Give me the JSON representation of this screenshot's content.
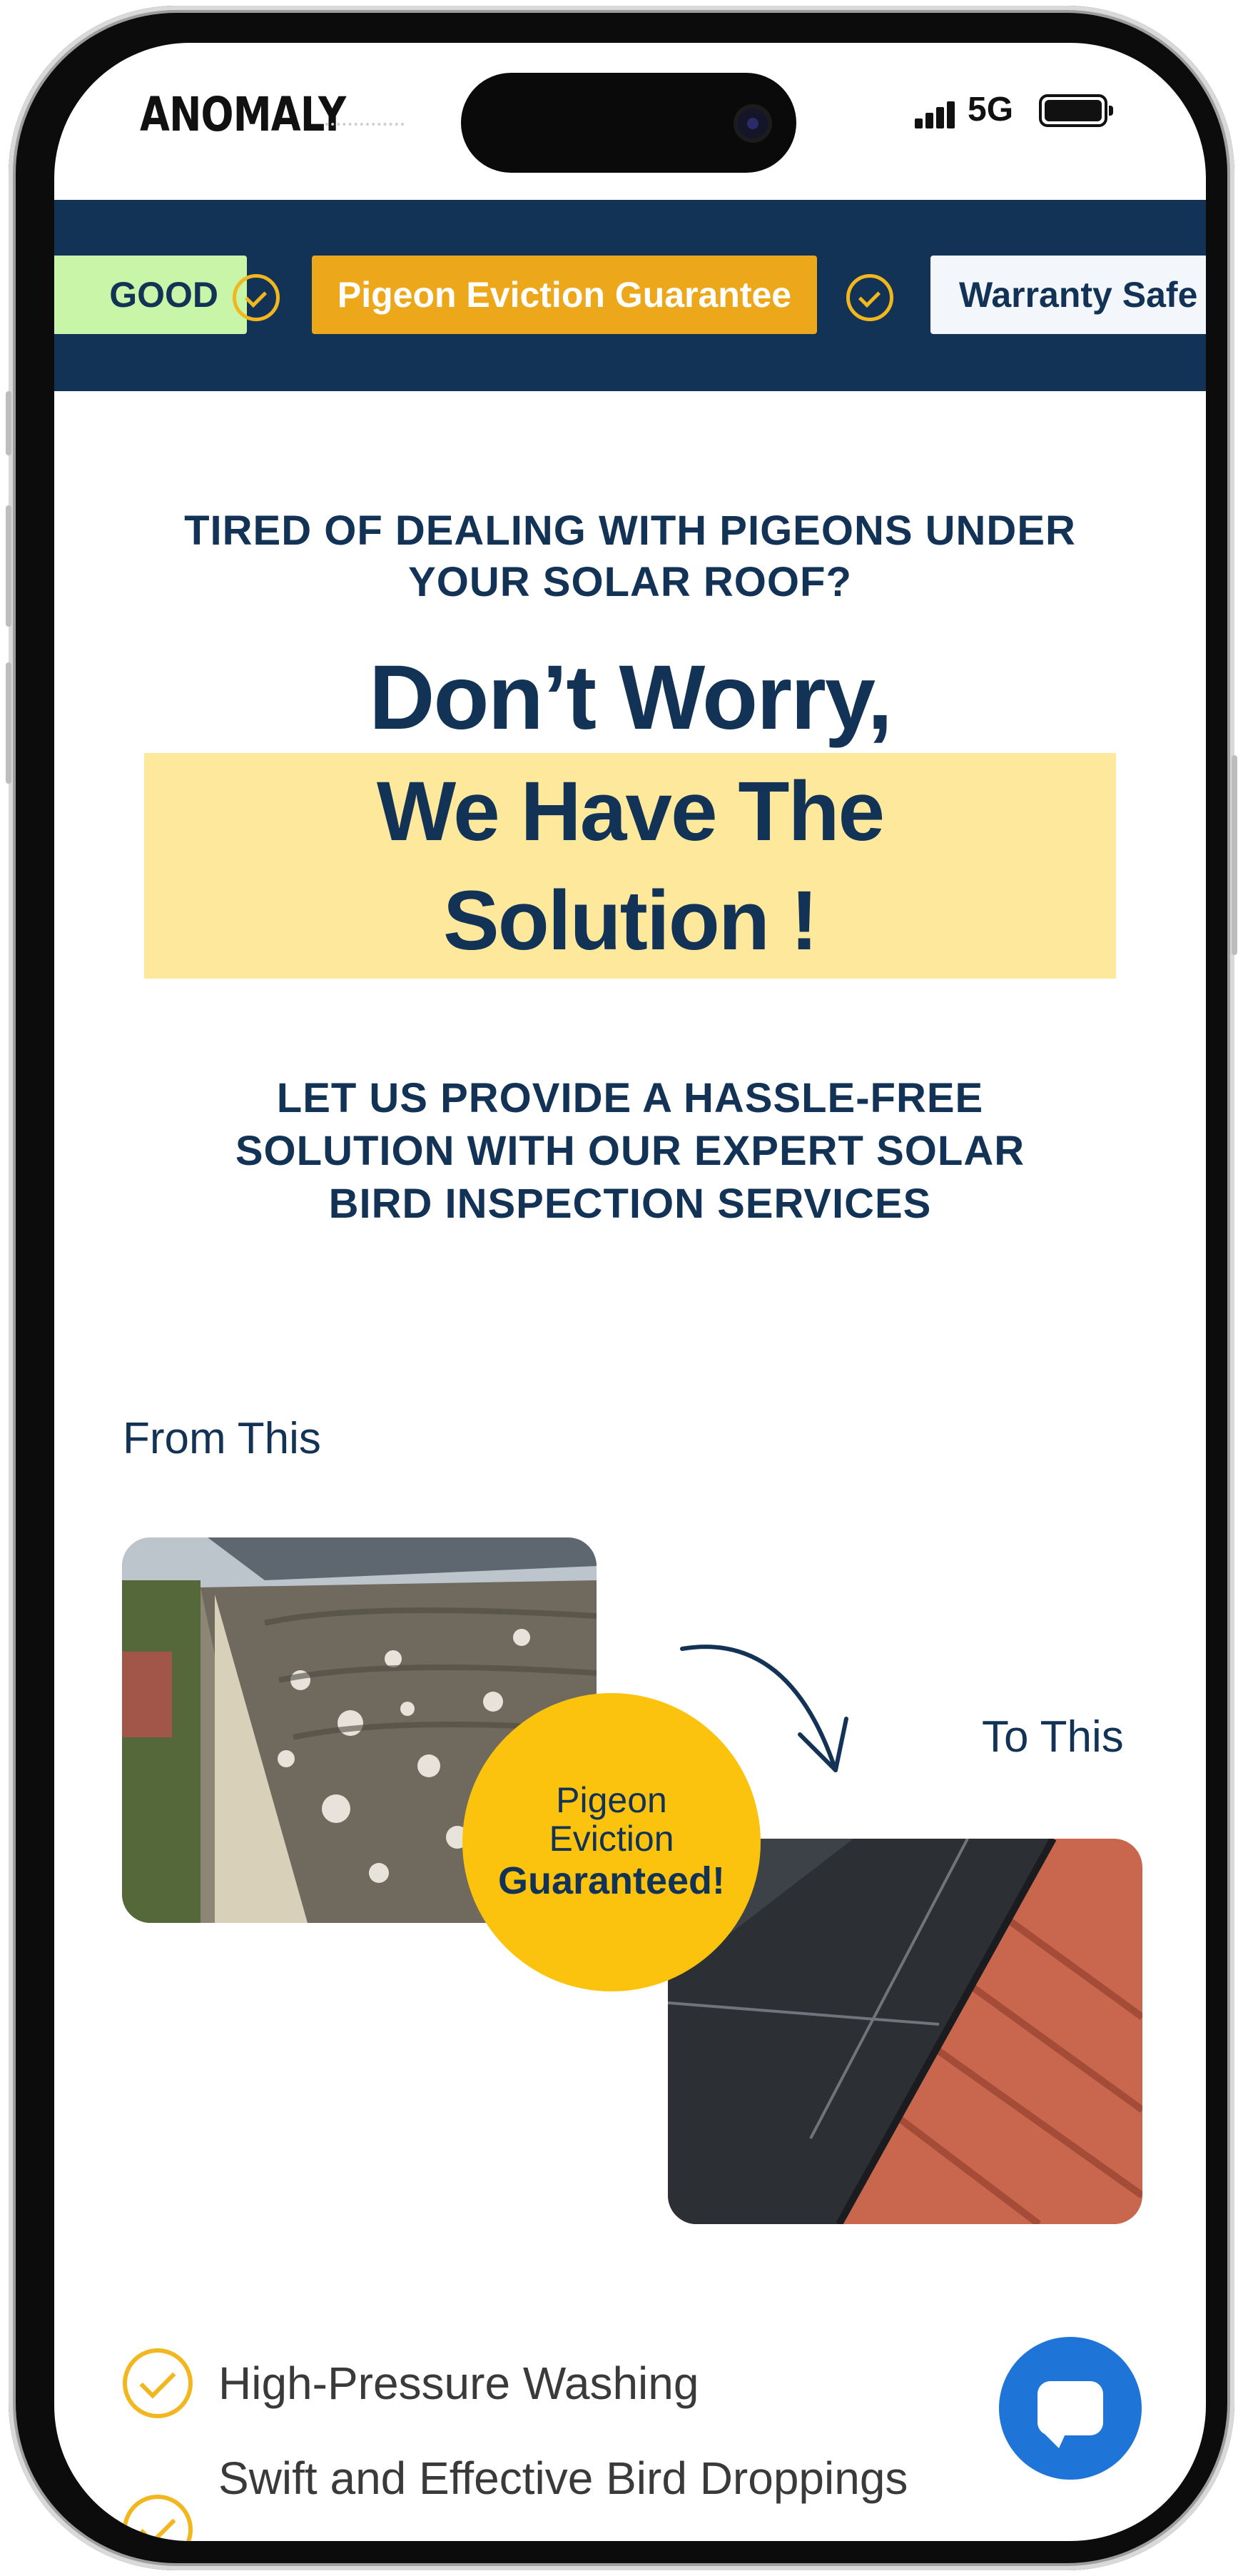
{
  "status_bar": {
    "brand": "ANOMALY",
    "network": "5G"
  },
  "ribbon": {
    "badges": [
      {
        "label": "GOOD",
        "color": "#c8f5a8"
      },
      {
        "label": "Pigeon Eviction Guarantee",
        "color": "#eca71a"
      },
      {
        "label": "Warranty Safe",
        "color": "#f3f6fb"
      }
    ],
    "icon": "check-circle-icon"
  },
  "hero": {
    "question_line1": "TIRED OF DEALING WITH PIGEONS UNDER",
    "question_line2": "YOUR SOLAR ROOF?",
    "headline_line1": "Don’t Worry,",
    "headline_line2": "We Have The",
    "headline_line3": "Solution !",
    "subtext_line1": "LET US PROVIDE A HASSLE-FREE",
    "subtext_line2": "SOLUTION WITH OUR EXPERT SOLAR",
    "subtext_line3": "BIRD INSPECTION SERVICES"
  },
  "comparison": {
    "from_label": "From This",
    "to_label": "To This",
    "seal_line1": "Pigeon",
    "seal_line2": "Eviction",
    "seal_line3": "Guaranteed!"
  },
  "features": [
    "High-Pressure Washing",
    "Swift and Effective Bird Droppings"
  ],
  "colors": {
    "navy": "#133356",
    "highlight": "#fde89c",
    "gold": "#fcc30e",
    "chat_blue": "#1f74d8"
  }
}
